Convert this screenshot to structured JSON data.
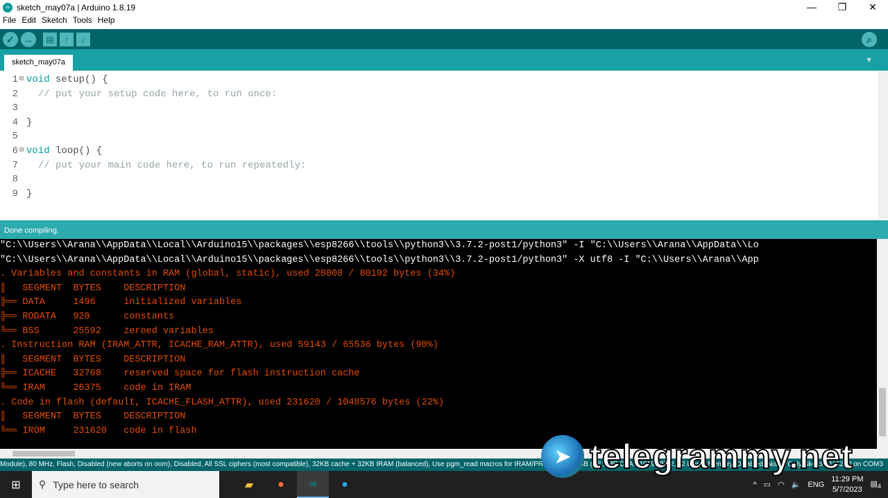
{
  "window": {
    "title": "sketch_may07a | Arduino 1.8.19",
    "minimize": "—",
    "maximize": "❐",
    "close": "✕"
  },
  "menu": [
    "File",
    "Edit",
    "Sketch",
    "Tools",
    "Help"
  ],
  "toolbar": {
    "verify": "✓",
    "upload": "→",
    "new": "▤",
    "open": "↑",
    "save": "↓",
    "serial": "⌕"
  },
  "tab": {
    "label": "sketch_may07a",
    "menu": "▼"
  },
  "editor": {
    "lines": [
      {
        "n": "1",
        "fold": "⊟",
        "kw": "void",
        "rest": " setup() {",
        "cm": ""
      },
      {
        "n": "2",
        "fold": "",
        "kw": "",
        "rest": "  ",
        "cm": "// put your setup code here, to run once:"
      },
      {
        "n": "3",
        "fold": "",
        "kw": "",
        "rest": "",
        "cm": ""
      },
      {
        "n": "4",
        "fold": "",
        "kw": "",
        "rest": "}",
        "cm": ""
      },
      {
        "n": "5",
        "fold": "",
        "kw": "",
        "rest": "",
        "cm": ""
      },
      {
        "n": "6",
        "fold": "⊟",
        "kw": "void",
        "rest": " loop() {",
        "cm": ""
      },
      {
        "n": "7",
        "fold": "",
        "kw": "",
        "rest": "  ",
        "cm": "// put your main code here, to run repeatedly:"
      },
      {
        "n": "8",
        "fold": "",
        "kw": "",
        "rest": "",
        "cm": ""
      },
      {
        "n": "9",
        "fold": "",
        "kw": "",
        "rest": "}",
        "cm": ""
      }
    ]
  },
  "status": "Done compiling.",
  "console": [
    {
      "t": "\"C:\\\\Users\\\\Arana\\\\AppData\\\\Local\\\\Arduino15\\\\packages\\\\esp8266\\\\tools\\\\python3\\\\3.7.2-post1/python3\" -I \"C:\\\\Users\\\\Arana\\\\AppData\\\\Lo",
      "w": true
    },
    {
      "t": "\"C:\\\\Users\\\\Arana\\\\AppData\\\\Local\\\\Arduino15\\\\packages\\\\esp8266\\\\tools\\\\python3\\\\3.7.2-post1/python3\" -X utf8 -I \"C:\\\\Users\\\\Arana\\\\App",
      "w": true
    },
    {
      "t": ". Variables and constants in RAM (global, static), used 28008 / 80192 bytes (34%)",
      "w": false
    },
    {
      "t": "║   SEGMENT  BYTES    DESCRIPTION",
      "w": false
    },
    {
      "t": "╠══ DATA     1496     initialized variables",
      "w": false
    },
    {
      "t": "╠══ RODATA   920      constants",
      "w": false
    },
    {
      "t": "╚══ BSS      25592    zeroed variables",
      "w": false
    },
    {
      "t": ". Instruction RAM (IRAM_ATTR, ICACHE_RAM_ATTR), used 59143 / 65536 bytes (90%)",
      "w": false
    },
    {
      "t": "║   SEGMENT  BYTES    DESCRIPTION",
      "w": false
    },
    {
      "t": "╠══ ICACHE   32768    reserved space for flash instruction cache",
      "w": false
    },
    {
      "t": "╚══ IRAM     26375    code in IRAM",
      "w": false
    },
    {
      "t": ". Code in flash (default, ICACHE_FLASH_ATTR), used 231620 / 1048576 bytes (22%)",
      "w": false
    },
    {
      "t": "║   SEGMENT  BYTES    DESCRIPTION",
      "w": false
    },
    {
      "t": "╚══ IROM     231620   code in flash",
      "w": false
    }
  ],
  "boardbar": "Module), 80 MHz, Flash, Disabled (new aborts on oom), Disabled, All SSL ciphers (most compatible), 32KB cache + 32KB IRAM (balanced), Use pgm_read macros for IRAM/PROGMEM, 4MB (FS:2MB OTA:~1019KB), 2, v2 Lower Memory, Disabled, None, Only Sketch, 115200 on COM3",
  "taskbar": {
    "search_placeholder": "Type here to search",
    "lang": "ENG",
    "time": "11:29 PM",
    "date": "5/7/2023",
    "notifications": "4"
  },
  "watermark": "telegrammy.net",
  "colors": {
    "toolbar": "#006468",
    "tabbar": "#17a1a5",
    "console_text": "#e34c00"
  }
}
